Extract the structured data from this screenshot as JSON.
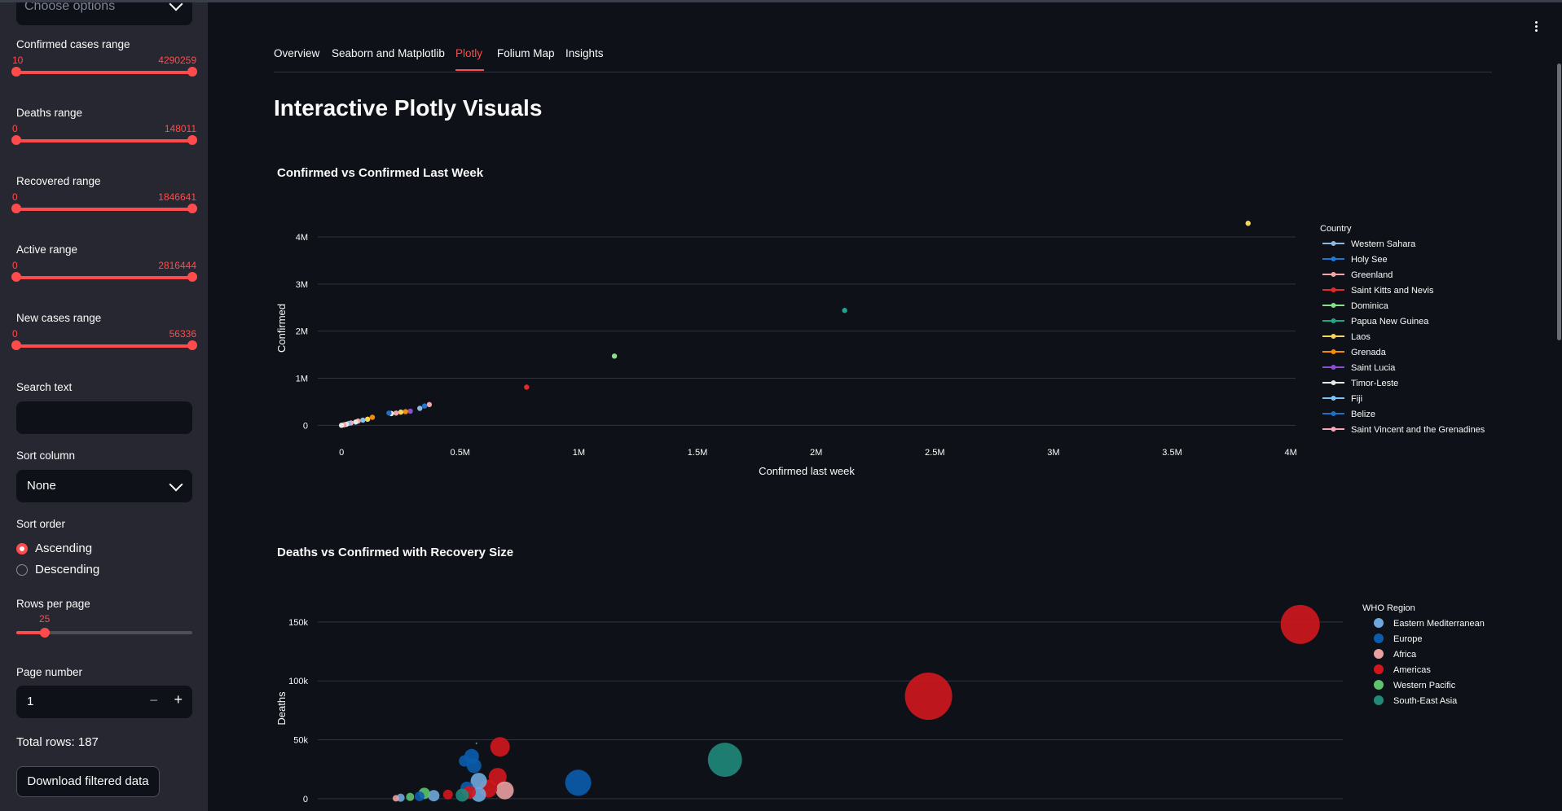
{
  "sidebar": {
    "multiselect_placeholder": "Choose options",
    "sliders": [
      {
        "label": "Confirmed cases range",
        "min": "10",
        "max": "4290259"
      },
      {
        "label": "Deaths range",
        "min": "0",
        "max": "148011"
      },
      {
        "label": "Recovered range",
        "min": "0",
        "max": "1846641"
      },
      {
        "label": "Active range",
        "min": "0",
        "max": "2816444"
      },
      {
        "label": "New cases range",
        "min": "0",
        "max": "56336"
      }
    ],
    "search_label": "Search text",
    "search_value": "",
    "sort_column_label": "Sort column",
    "sort_column_value": "None",
    "sort_order_label": "Sort order",
    "sort_order_options": [
      "Ascending",
      "Descending"
    ],
    "sort_order_selected": "Ascending",
    "rows_per_page_label": "Rows per page",
    "rows_per_page_value": "25",
    "rows_per_page_fraction": 0.13,
    "page_number_label": "Page number",
    "page_number_value": "1",
    "total_rows": "Total rows: 187",
    "download_label": "Download filtered data"
  },
  "tabs": [
    "Overview",
    "Seaborn and Matplotlib",
    "Plotly",
    "Folium Map",
    "Insights"
  ],
  "active_tab": "Plotly",
  "page_title": "Interactive Plotly Visuals",
  "icons": {
    "menu": "kebab-menu-icon",
    "select": "chevron-down-icon",
    "decrement": "minus-icon",
    "increment": "plus-icon"
  },
  "colors": {
    "accent": "#ff4b4b",
    "background": "#0e1117",
    "sidebar": "#262730"
  },
  "chart_data": [
    {
      "type": "scatter",
      "title": "Confirmed vs Confirmed Last Week",
      "xlabel": "Confirmed last week",
      "ylabel": "Confirmed",
      "xlim": [
        -0.1,
        4.02
      ],
      "ylim": [
        -0.15,
        4.45
      ],
      "x_ticks": [
        {
          "v": 0,
          "t": "0"
        },
        {
          "v": 0.5,
          "t": "0.5M"
        },
        {
          "v": 1,
          "t": "1M"
        },
        {
          "v": 1.5,
          "t": "1.5M"
        },
        {
          "v": 2,
          "t": "2M"
        },
        {
          "v": 2.5,
          "t": "2.5M"
        },
        {
          "v": 3,
          "t": "3M"
        },
        {
          "v": 3.5,
          "t": "3.5M"
        },
        {
          "v": 4,
          "t": "4M"
        }
      ],
      "y_ticks": [
        {
          "v": 0,
          "t": "0"
        },
        {
          "v": 1,
          "t": "1M"
        },
        {
          "v": 2,
          "t": "2M"
        },
        {
          "v": 3,
          "t": "3M"
        },
        {
          "v": 4,
          "t": "4M"
        }
      ],
      "legend_title": "Country",
      "legend_position": "right",
      "legend": [
        {
          "name": "Western Sahara",
          "color": "#8fb8de"
        },
        {
          "name": "Holy See",
          "color": "#1f77d4"
        },
        {
          "name": "Greenland",
          "color": "#f4a6a6"
        },
        {
          "name": "Saint Kitts and Nevis",
          "color": "#e8272d"
        },
        {
          "name": "Dominica",
          "color": "#86e08b"
        },
        {
          "name": "Papua New Guinea",
          "color": "#1fa589"
        },
        {
          "name": "Laos",
          "color": "#f6d55c"
        },
        {
          "name": "Grenada",
          "color": "#f48c06"
        },
        {
          "name": "Saint Lucia",
          "color": "#8b4fd4"
        },
        {
          "name": "Timor-Leste",
          "color": "#e8e8e8"
        },
        {
          "name": "Fiji",
          "color": "#7fc3f5"
        },
        {
          "name": "Belize",
          "color": "#1f6fc4"
        },
        {
          "name": "Saint Vincent and the Grenadines",
          "color": "#f7a8b8"
        }
      ],
      "points": [
        {
          "x": 3.82,
          "y": 4.29,
          "color": "#f6d55c"
        },
        {
          "x": 2.12,
          "y": 2.44,
          "color": "#1fa589"
        },
        {
          "x": 1.15,
          "y": 1.47,
          "color": "#86e08b"
        },
        {
          "x": 0.78,
          "y": 0.81,
          "color": "#e8272d"
        },
        {
          "x": 0.37,
          "y": 0.44,
          "color": "#f4a6a6"
        },
        {
          "x": 0.35,
          "y": 0.41,
          "color": "#1f77d4"
        },
        {
          "x": 0.33,
          "y": 0.36,
          "color": "#8fb8de"
        },
        {
          "x": 0.29,
          "y": 0.3,
          "color": "#8b4fd4"
        },
        {
          "x": 0.27,
          "y": 0.29,
          "color": "#f48c06"
        },
        {
          "x": 0.25,
          "y": 0.28,
          "color": "#f6d55c"
        },
        {
          "x": 0.23,
          "y": 0.26,
          "color": "#f4a6a6"
        },
        {
          "x": 0.21,
          "y": 0.25,
          "color": "#e8e8e8"
        },
        {
          "x": 0.2,
          "y": 0.26,
          "color": "#1f6fc4"
        },
        {
          "x": 0.13,
          "y": 0.17,
          "color": "#f48c06"
        },
        {
          "x": 0.11,
          "y": 0.13,
          "color": "#f6d55c"
        },
        {
          "x": 0.09,
          "y": 0.11,
          "color": "#7fc3f5"
        },
        {
          "x": 0.07,
          "y": 0.09,
          "color": "#f4a6a6"
        },
        {
          "x": 0.06,
          "y": 0.07,
          "color": "#e8e8e8"
        },
        {
          "x": 0.04,
          "y": 0.05,
          "color": "#f7a8b8"
        },
        {
          "x": 0.03,
          "y": 0.04,
          "color": "#8fb8de"
        },
        {
          "x": 0.02,
          "y": 0.02,
          "color": "#e8e8e8"
        },
        {
          "x": 0.01,
          "y": 0.01,
          "color": "#f4a6a6"
        },
        {
          "x": 0.0,
          "y": 0.0,
          "color": "#e8e8e8"
        }
      ]
    },
    {
      "type": "scatter",
      "title": "Deaths vs Confirmed with Recovery Size",
      "ylabel": "Deaths",
      "xlim": [
        -0.33,
        4.0
      ],
      "ylim": [
        -1.5,
        170
      ],
      "y_ticks": [
        {
          "v": 0,
          "t": "0"
        },
        {
          "v": 50,
          "t": "50k"
        },
        {
          "v": 100,
          "t": "100k"
        },
        {
          "v": 150,
          "t": "150k"
        }
      ],
      "legend_title": "WHO Region",
      "legend_position": "right",
      "legend": [
        {
          "name": "Eastern Mediterranean",
          "color": "#6fa8dc"
        },
        {
          "name": "Europe",
          "color": "#0b5cad"
        },
        {
          "name": "Africa",
          "color": "#e8a0a0"
        },
        {
          "name": "Americas",
          "color": "#d0171e"
        },
        {
          "name": "Western Pacific",
          "color": "#5cc46e"
        },
        {
          "name": "South-East Asia",
          "color": "#1f8a7a"
        }
      ],
      "points": [
        {
          "x": 3.82,
          "y": 148.0,
          "r": 24,
          "color": "#d0171e"
        },
        {
          "x": 2.25,
          "y": 87.0,
          "r": 29,
          "color": "#d0171e"
        },
        {
          "x": 1.39,
          "y": 33.0,
          "r": 21,
          "color": "#1f8a7a"
        },
        {
          "x": 0.77,
          "y": 13.5,
          "r": 16,
          "color": "#0b5cad"
        },
        {
          "x": 0.44,
          "y": 44.0,
          "r": 12,
          "color": "#d0171e"
        },
        {
          "x": 0.43,
          "y": 18.5,
          "r": 11,
          "color": "#d0171e"
        },
        {
          "x": 0.46,
          "y": 7.0,
          "r": 11,
          "color": "#e8a0a0"
        },
        {
          "x": 0.39,
          "y": 8.5,
          "r": 11,
          "color": "#d0171e"
        },
        {
          "x": 0.35,
          "y": 15.0,
          "r": 10,
          "color": "#6fa8dc"
        },
        {
          "x": 0.32,
          "y": 36.0,
          "r": 9,
          "color": "#0b5cad"
        },
        {
          "x": 0.33,
          "y": 28.0,
          "r": 9,
          "color": "#0b5cad"
        },
        {
          "x": 0.29,
          "y": 32.0,
          "r": 7,
          "color": "#0b5cad"
        },
        {
          "x": 0.35,
          "y": 3.5,
          "r": 9,
          "color": "#6fa8dc"
        },
        {
          "x": 0.3,
          "y": 9.0,
          "r": 8,
          "color": "#0b5cad"
        },
        {
          "x": 0.31,
          "y": 5.5,
          "r": 8,
          "color": "#d0171e"
        },
        {
          "x": 0.28,
          "y": 3.0,
          "r": 8,
          "color": "#1f8a7a"
        },
        {
          "x": 0.22,
          "y": 3.5,
          "r": 6,
          "color": "#d0171e"
        },
        {
          "x": 0.16,
          "y": 2.5,
          "r": 7,
          "color": "#6fa8dc"
        },
        {
          "x": 0.12,
          "y": 4.5,
          "r": 7,
          "color": "#5cc46e"
        },
        {
          "x": 0.1,
          "y": 2.0,
          "r": 6,
          "color": "#0b5cad"
        },
        {
          "x": 0.06,
          "y": 1.5,
          "r": 5,
          "color": "#5cc46e"
        },
        {
          "x": 0.02,
          "y": 0.8,
          "r": 5,
          "color": "#6fa8dc"
        },
        {
          "x": 0.0,
          "y": 0.3,
          "r": 4,
          "color": "#e8a0a0"
        },
        {
          "x": 0.34,
          "y": 47.0,
          "r": 1,
          "color": "#5cc46e"
        }
      ]
    }
  ]
}
